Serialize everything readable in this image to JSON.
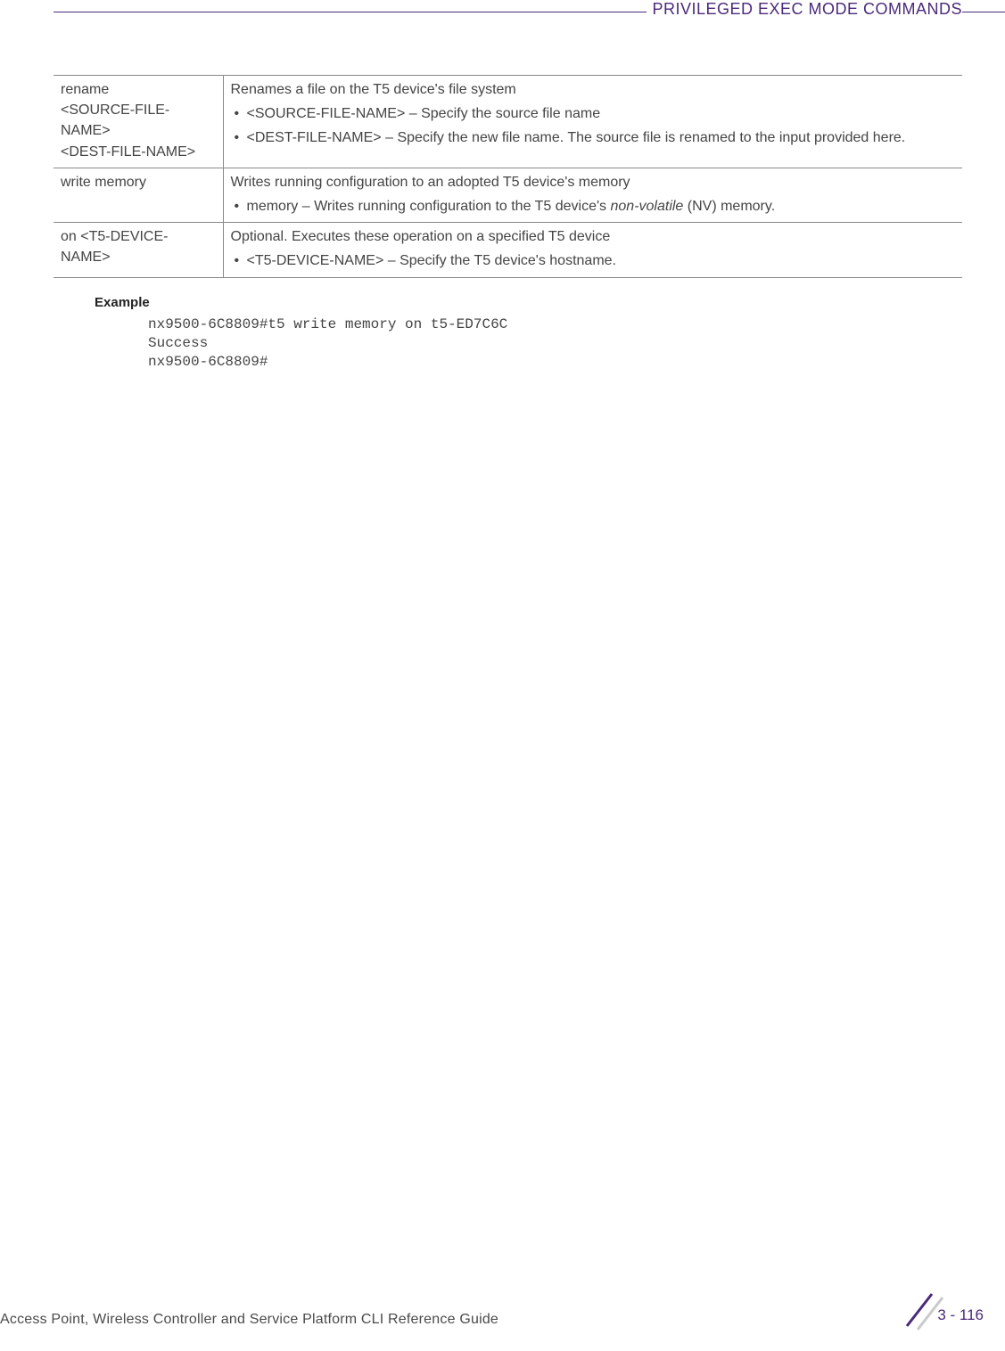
{
  "header": {
    "title": "PRIVILEGED EXEC MODE COMMANDS"
  },
  "table": {
    "rows": [
      {
        "cmd_lines": [
          "rename",
          "<SOURCE-FILE-NAME>",
          "<DEST-FILE-NAME>"
        ],
        "desc": "Renames a file on the T5 device's file system",
        "bullets": [
          "<SOURCE-FILE-NAME> – Specify the source file name",
          "<DEST-FILE-NAME> – Specify the new file name. The source file is renamed to the input provided here."
        ]
      },
      {
        "cmd_lines": [
          "write memory"
        ],
        "desc": "Writes running configuration to an adopted T5 device's memory",
        "bullets_html": [
          "memory – Writes running configuration to the T5 device's <span class=\"italic\">non-volatile</span> (NV) memory."
        ]
      },
      {
        "cmd_lines": [
          "on <T5-DEVICE-NAME>"
        ],
        "desc": "Optional. Executes these operation on a specified T5 device",
        "bullets": [
          "<T5-DEVICE-NAME> – Specify the T5 device's hostname."
        ]
      }
    ]
  },
  "example": {
    "label": "Example",
    "code": "nx9500-6C8809#t5 write memory on t5-ED7C6C\nSuccess\nnx9500-6C8809#"
  },
  "footer": {
    "guide": "Access Point, Wireless Controller and Service Platform CLI Reference Guide",
    "page": "3 - 116"
  }
}
